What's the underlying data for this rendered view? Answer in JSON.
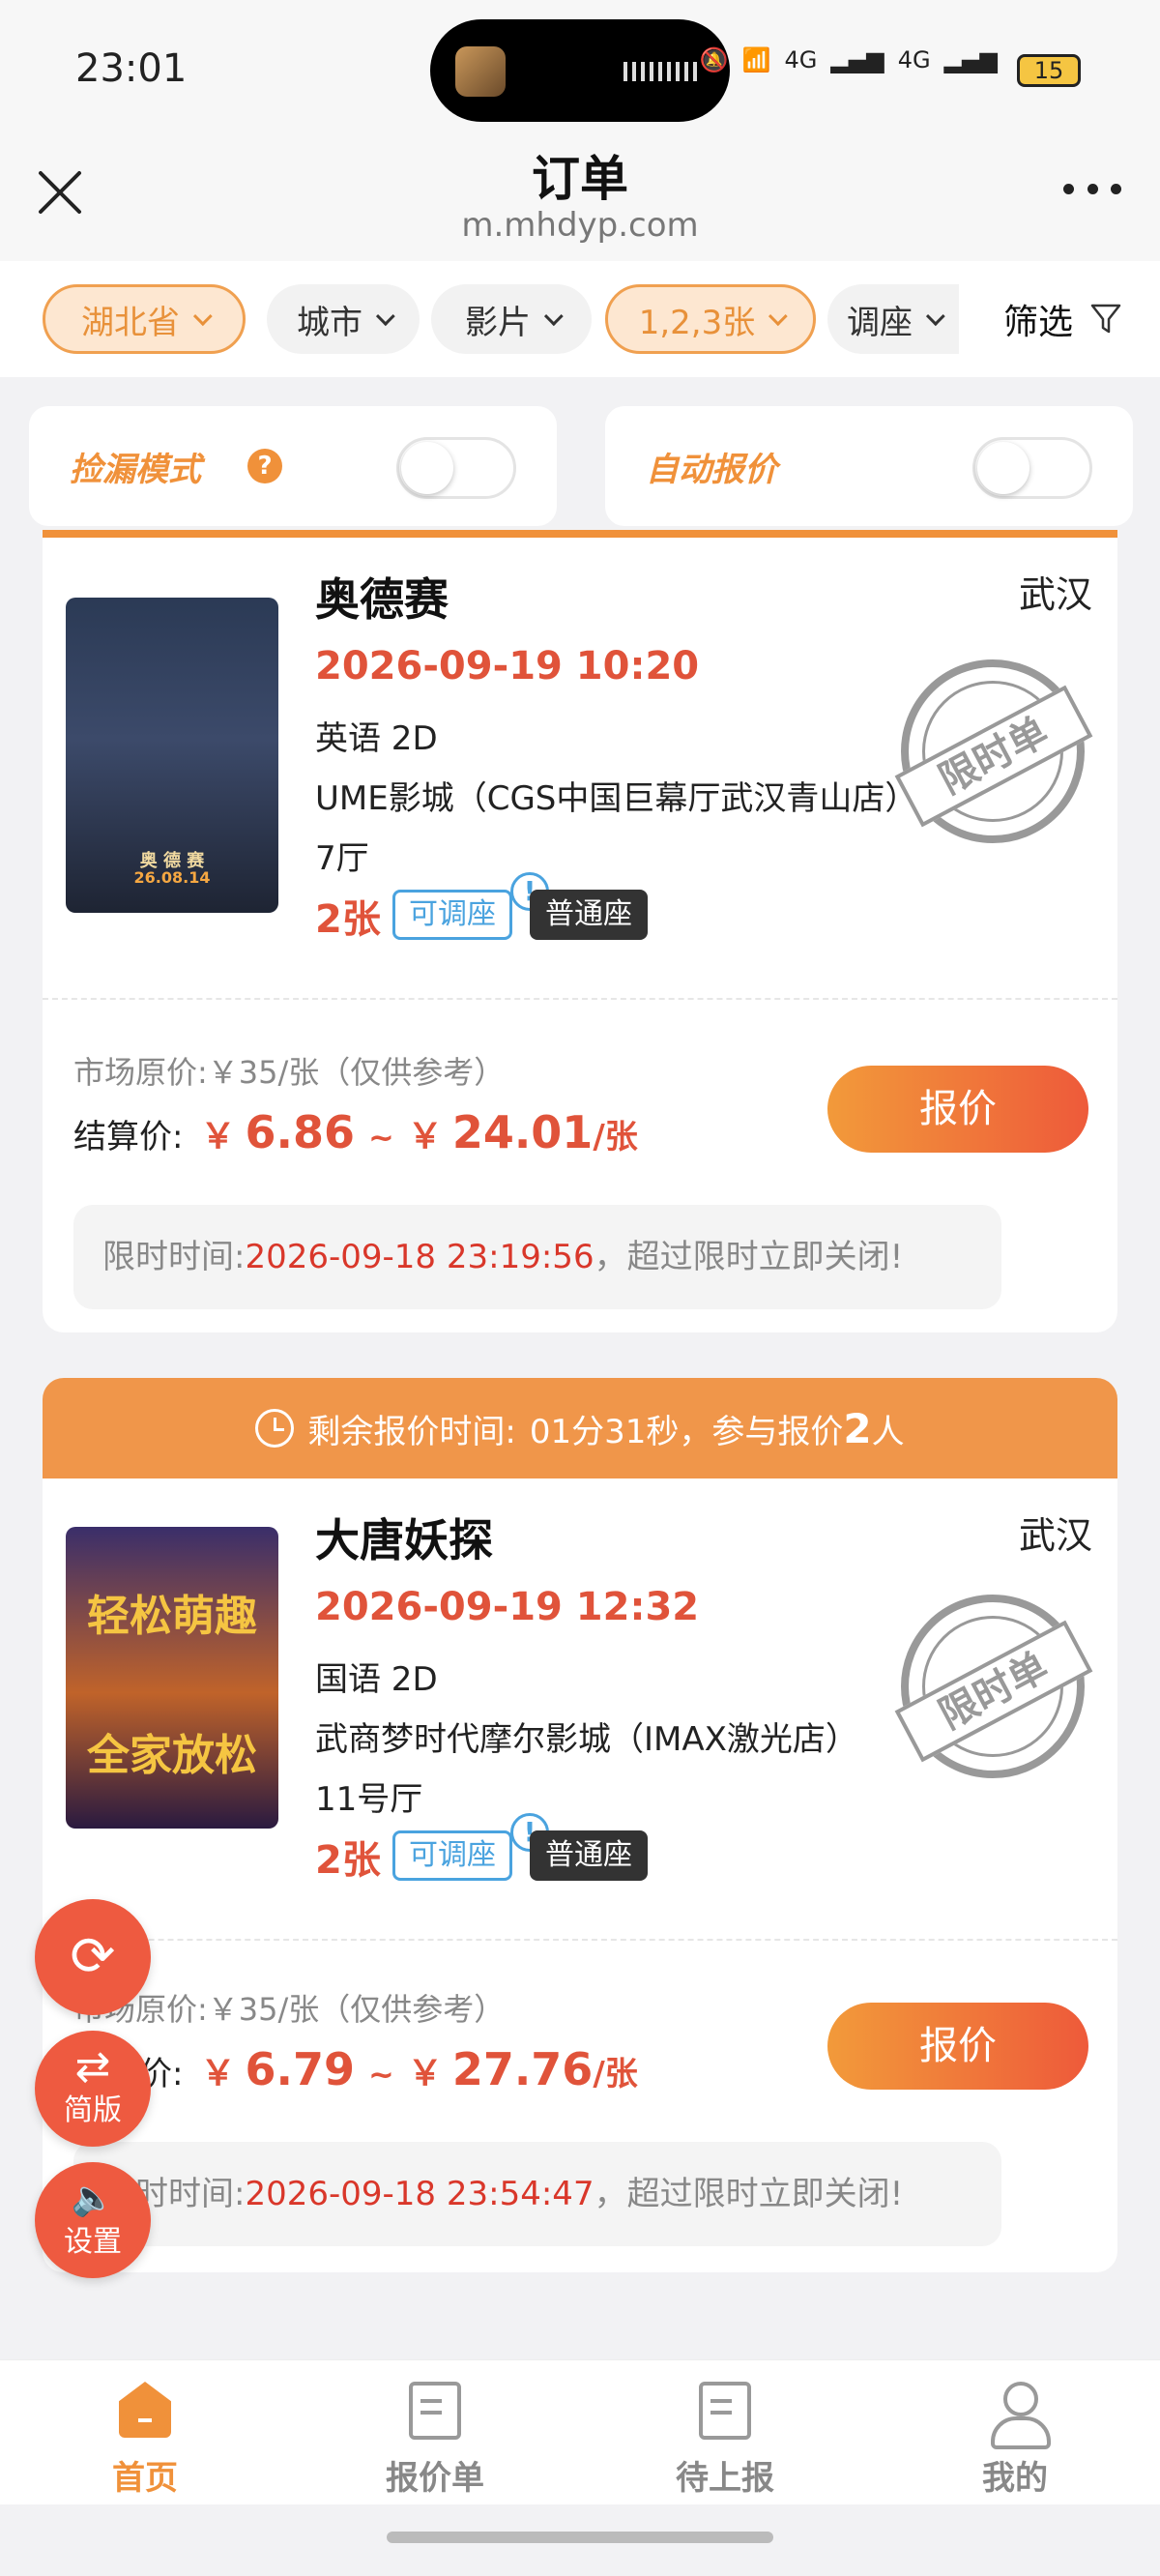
{
  "status": {
    "time": "23:01",
    "battery": "15",
    "net1": "4G",
    "net2": "4G"
  },
  "header": {
    "title": "订单",
    "url": "m.mhdyp.com"
  },
  "filters": {
    "province": "湖北省",
    "city": "城市",
    "movie": "影片",
    "tickets": "1,2,3张",
    "seat": "调座",
    "filter": "筛选"
  },
  "toggles": {
    "leak_mode": "捡漏模式",
    "auto_quote": "自动报价",
    "leak_mode_on": false,
    "auto_quote_on": false
  },
  "orders": [
    {
      "title": "奥德赛",
      "city": "武汉",
      "showtime": "2026-09-19 10:20",
      "format": "英语 2D",
      "cinema": "UME影城（CGS中国巨幕厅武汉青山店）",
      "hall": "7厅",
      "tickets": "2张",
      "tag_adjust": "可调座",
      "tag_seat": "普通座",
      "stamp": "限时单",
      "poster_text": "奥 德 赛",
      "poster_date": "26.08.14",
      "market_price": "市场原价:￥35/张（仅供参考）",
      "settle_label": "结算价:",
      "yen": "￥",
      "price_min": "6.86",
      "tilde": "~",
      "price_max": "24.01",
      "unit": "/张",
      "quote_button": "报价",
      "deadline_label": "限时时间:",
      "deadline": "2026-09-18 23:19:56",
      "deadline_suffix": "，超过限时立即关闭!"
    },
    {
      "banner_prefix": "剩余报价时间:",
      "banner_time": "01分31秒",
      "banner_mid": "，参与报价",
      "banner_count": "2",
      "banner_suffix": "人",
      "title": "大唐妖探",
      "city": "武汉",
      "showtime": "2026-09-19 12:32",
      "format": "国语 2D",
      "cinema": "武商梦时代摩尔影城（IMAX激光店）",
      "hall": "11号厅",
      "tickets": "2张",
      "tag_adjust": "可调座",
      "tag_seat": "普通座",
      "stamp": "限时单",
      "poster_text_top": "轻松萌趣",
      "poster_text_bottom": "全家放松",
      "market_price": "市场原价:￥35/张（仅供参考）",
      "settle_label": "结算价:",
      "yen": "￥",
      "price_min": "6.79",
      "tilde": "~",
      "price_max": "27.76",
      "unit": "/张",
      "quote_button": "报价",
      "deadline_label": "限时时间:",
      "deadline": "2026-09-18 23:54:47",
      "deadline_suffix": "，超过限时立即关闭!"
    }
  ],
  "fabs": {
    "refresh_icon": "⟳",
    "simple_icon": "⇄",
    "simple_label": "简版",
    "settings_icon": "🔈",
    "settings_label": "设置"
  },
  "tabs": [
    {
      "label": "首页",
      "icon": "home-icon",
      "active": true
    },
    {
      "label": "报价单",
      "icon": "document-icon",
      "active": false
    },
    {
      "label": "待上报",
      "icon": "document-icon",
      "active": false
    },
    {
      "label": "我的",
      "icon": "user-icon",
      "active": false
    }
  ],
  "colors": {
    "accent": "#f0913a",
    "price_red": "#e0533a",
    "fab_red": "#ee5a40",
    "tag_blue": "#4aa3df"
  }
}
